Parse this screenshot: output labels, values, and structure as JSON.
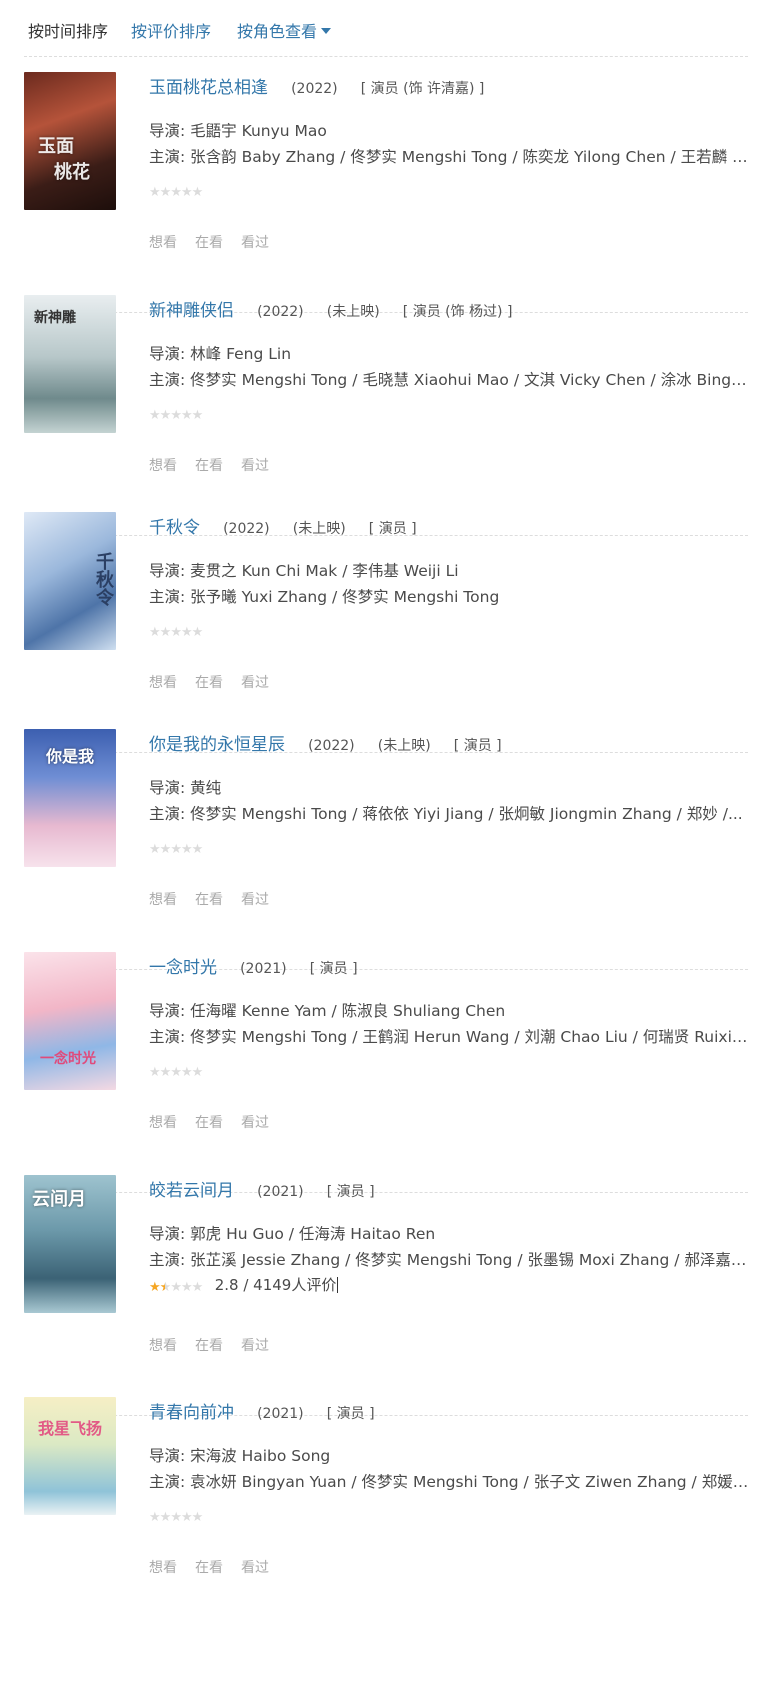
{
  "sortbar": {
    "by_time": "按时间排序",
    "by_rating": "按评价排序",
    "by_role": "按角色查看"
  },
  "actions": {
    "want": "想看",
    "watching": "在看",
    "watched": "看过"
  },
  "items": [
    {
      "title": "玉面桃花总相逢",
      "year": "(2022)",
      "status": "",
      "role": "[ 演员 (饰 许清嘉) ]",
      "directors": "导演: 毛鼯宇 Kunyu Mao",
      "cast": "主演: 张含韵 Baby Zhang / 佟梦实 Mengshi Tong / 陈奕龙 Yilong Chen / 王若麟 Ru...",
      "rating_stars": 0,
      "rating_text": ""
    },
    {
      "title": "新神雕侠侣",
      "year": "(2022)",
      "status": "(未上映)",
      "role": "[ 演员 (饰 杨过) ]",
      "directors": "导演: 林峰 Feng Lin",
      "cast": "主演: 佟梦实 Mengshi Tong / 毛晓慧 Xiaohui Mao / 文淇 Vicky Chen / 涂冰 Bing X...",
      "rating_stars": 0,
      "rating_text": ""
    },
    {
      "title": "千秋令",
      "year": "(2022)",
      "status": "(未上映)",
      "role": "[ 演员 ]",
      "directors": "导演: 麦贯之 Kun Chi Mak / 李伟基 Weiji Li",
      "cast": "主演: 张予曦 Yuxi Zhang / 佟梦实 Mengshi Tong",
      "rating_stars": 0,
      "rating_text": ""
    },
    {
      "title": "你是我的永恒星辰",
      "year": "(2022)",
      "status": "(未上映)",
      "role": "[ 演员 ]",
      "directors": "导演: 黄纯",
      "cast": "主演: 佟梦实 Mengshi Tong / 蒋依依 Yiyi Jiang / 张炯敏 Jiongmin Zhang / 郑妙 /...",
      "rating_stars": 0,
      "rating_text": ""
    },
    {
      "title": "一念时光",
      "year": "(2021)",
      "status": "",
      "role": "[ 演员 ]",
      "directors": "导演: 任海曜 Kenne Yam / 陈淑良 Shuliang Chen",
      "cast": "主演: 佟梦实 Mengshi Tong / 王鹤润 Herun Wang / 刘潮 Chao Liu / 何瑞贤 Ruixian...",
      "rating_stars": 0,
      "rating_text": ""
    },
    {
      "title": "皎若云间月",
      "year": "(2021)",
      "status": "",
      "role": "[ 演员 ]",
      "directors": "导演: 郭虎 Hu Guo / 任海涛 Haitao Ren",
      "cast": "主演: 张芷溪 Jessie Zhang / 佟梦实 Mengshi Tong / 张墨锡 Moxi Zhang / 郝泽嘉 Z...",
      "rating_stars": 1.5,
      "rating_text": "2.8 / 4149人评价"
    },
    {
      "title": "青春向前冲",
      "year": "(2021)",
      "status": "",
      "role": "[ 演员 ]",
      "directors": "导演: 宋海波 Haibo Song",
      "cast": "主演: 袁冰妍 Bingyan Yuan / 佟梦实 Mengshi Tong / 张子文 Ziwen Zhang / 郑媛元 ...",
      "rating_stars": 0,
      "rating_text": ""
    }
  ],
  "colors": {
    "link": "#3377aa",
    "star": "#f5a623",
    "star_empty": "#dcdcdc"
  }
}
